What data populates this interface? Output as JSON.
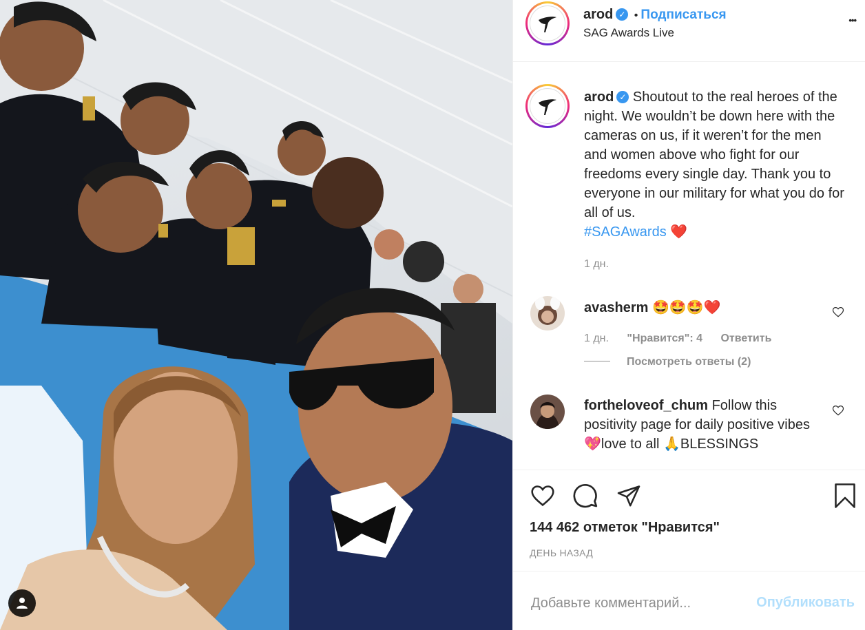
{
  "post": {
    "photo_alt": "",
    "author": "arod",
    "follow_label": "Подписаться",
    "separator": "•",
    "location": "SAG Awards Live",
    "more_label": "•••"
  },
  "caption": {
    "author": "arod",
    "text": "Shoutout to the real heroes of the night. We wouldn’t be down here with the cameras on us, if it weren’t for the men and women above who fight for our freedoms every single day. Thank you to everyone in our military for what you do for all of us.",
    "hashtag": "#SAGAwards",
    "heart": "❤️",
    "time": "1 дн."
  },
  "comments": [
    {
      "author": "avasherm",
      "text": "🤩🤩🤩❤️",
      "time": "1 дн.",
      "likes": "\"Нравится\": 4",
      "reply_label": "Ответить",
      "view_replies": "Посмотреть ответы (2)"
    },
    {
      "author": "fortheloveof_chum",
      "text": "Follow this positivity page for daily positive vibes 💖love to all 🙏BLESSINGS"
    }
  ],
  "stats": {
    "likes": "144 462 отметок \"Нравится\"",
    "date": "ДЕНЬ НАЗАД"
  },
  "composer": {
    "placeholder": "Добавьте комментарий...",
    "post_label": "Опубликовать"
  },
  "colors": {
    "accent": "#3897f0",
    "text": "#262626",
    "muted": "#8e8e8e",
    "heart": "#ed4956"
  }
}
